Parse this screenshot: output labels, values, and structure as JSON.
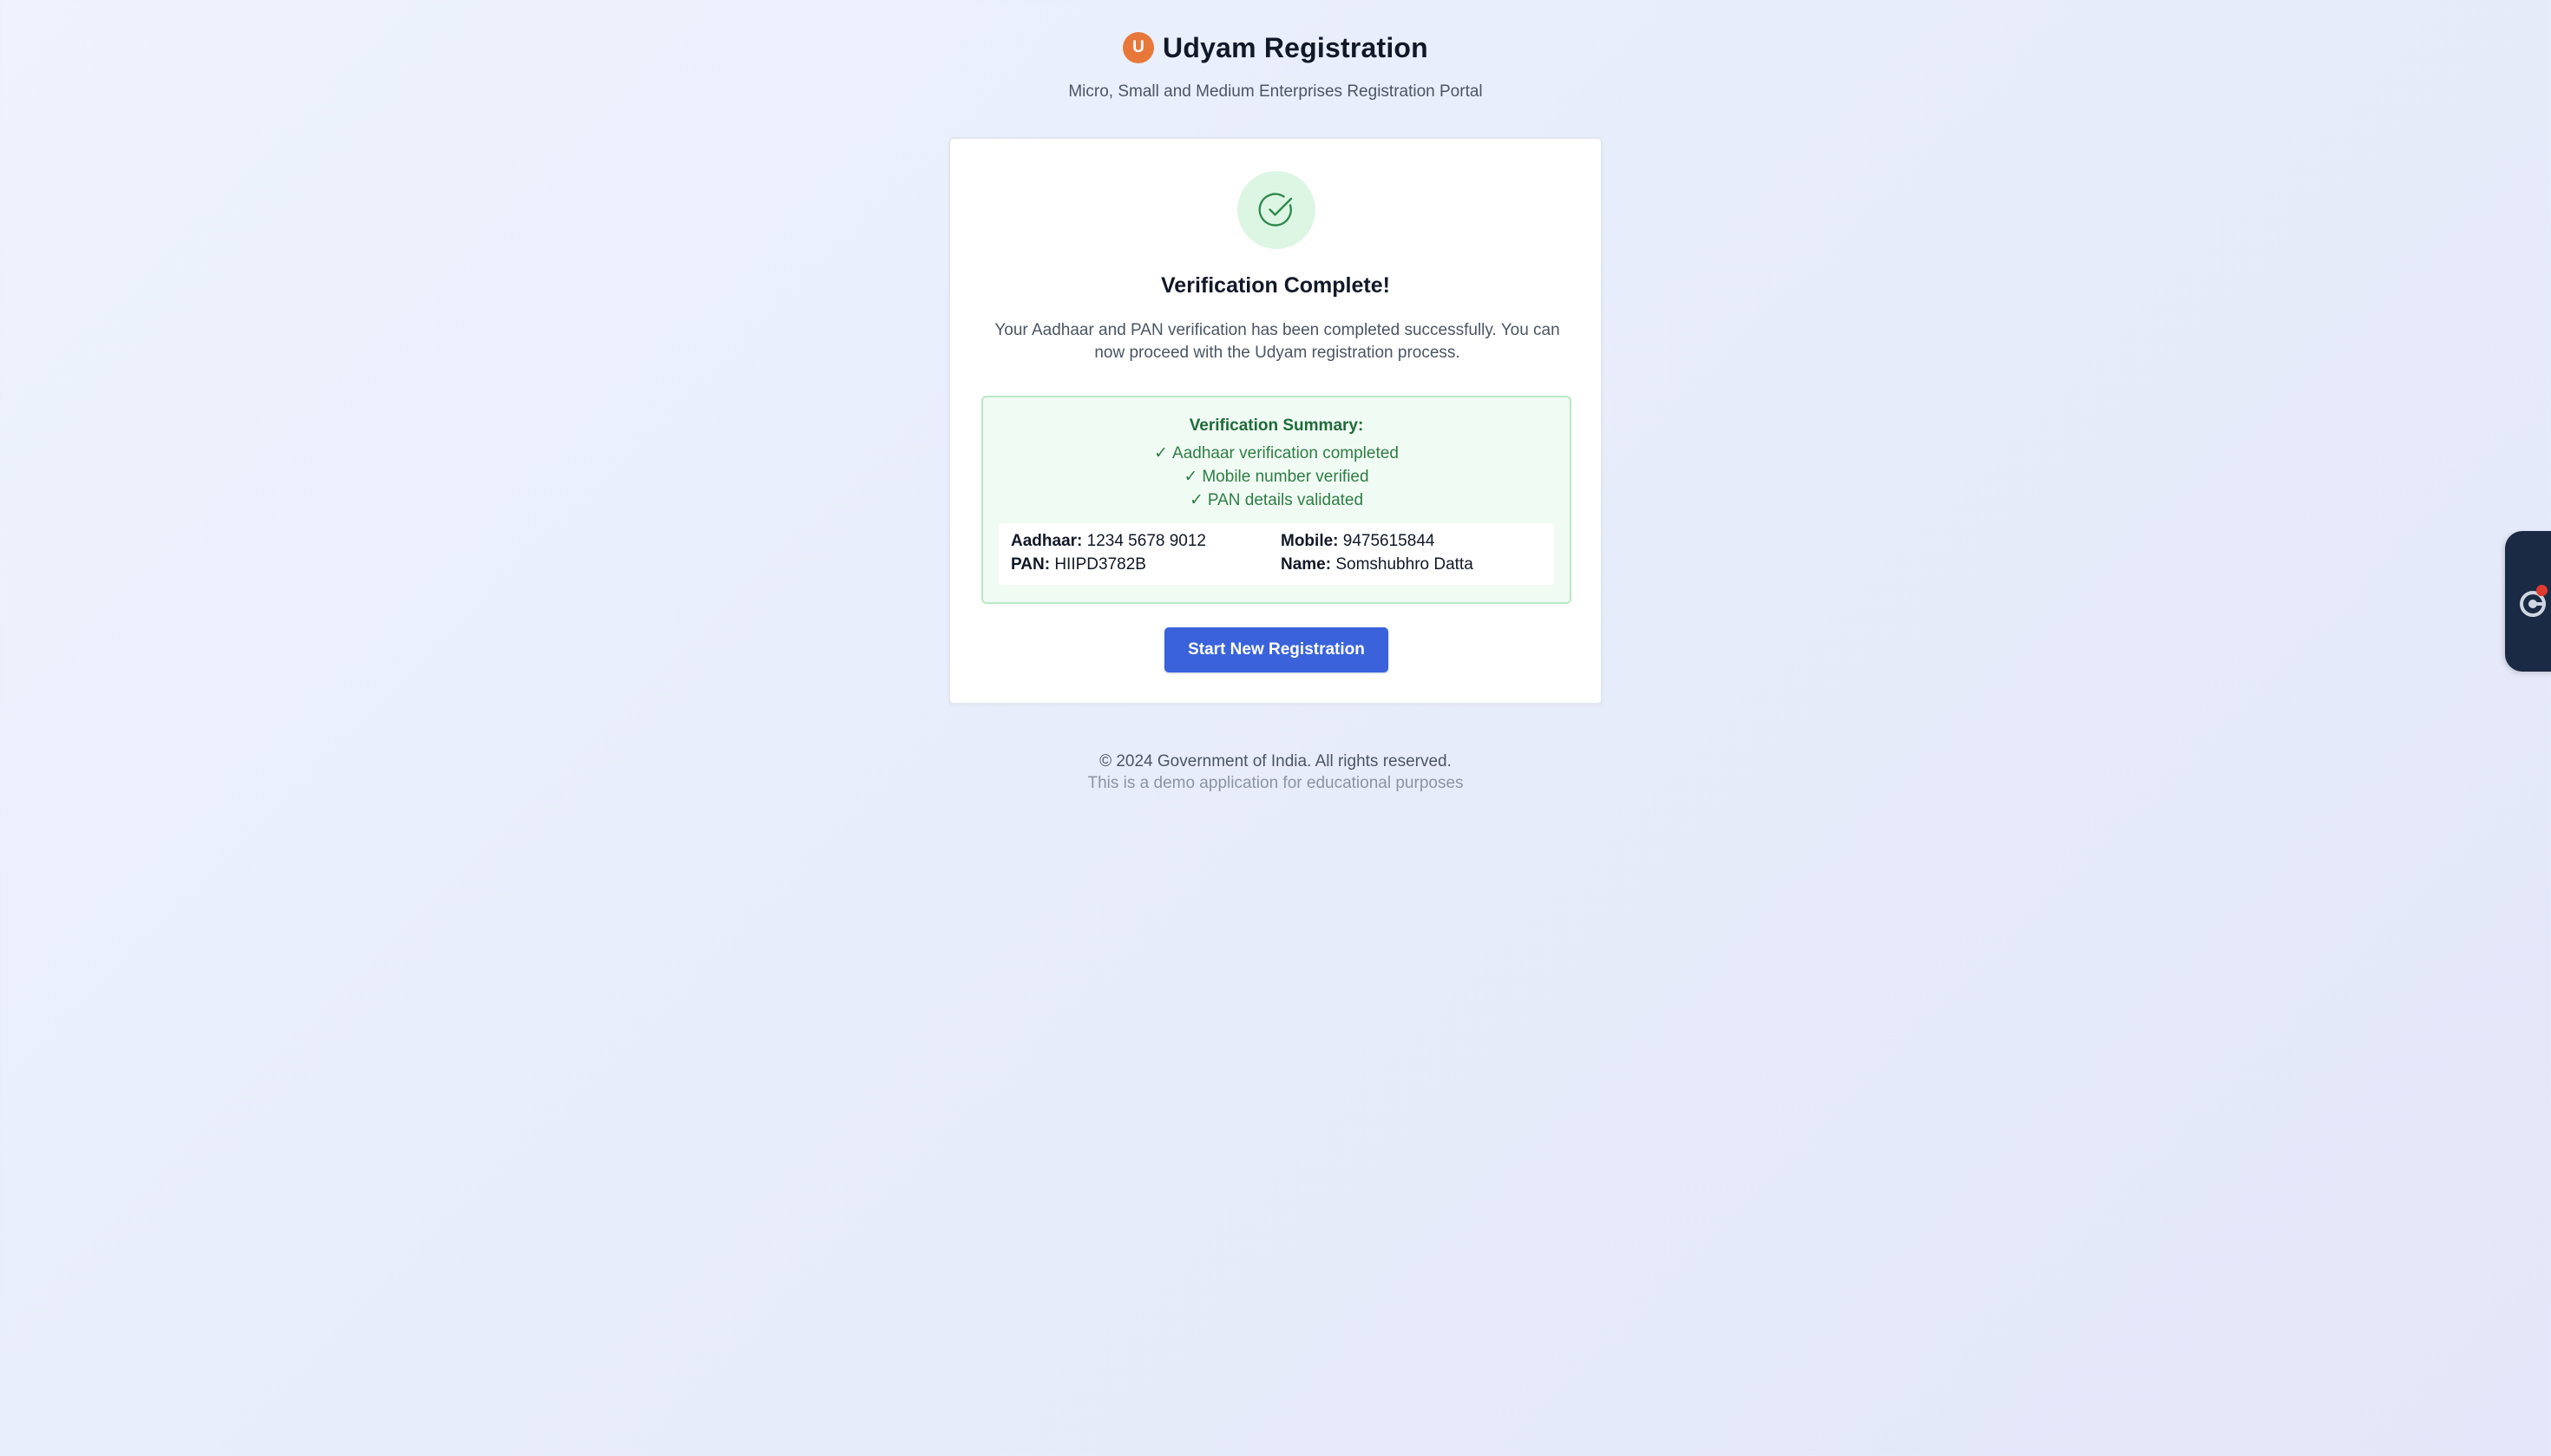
{
  "header": {
    "logo_letter": "U",
    "title": "Udyam Registration",
    "subtitle": "Micro, Small and Medium Enterprises Registration Portal"
  },
  "card": {
    "icon": "check-circle-icon",
    "title": "Verification Complete!",
    "message": "Your Aadhaar and PAN verification has been completed successfully. You can now proceed with the Udyam registration process.",
    "summary": {
      "title": "Verification Summary:",
      "check_glyph": "✓",
      "items": [
        "Aadhaar verification completed",
        "Mobile number verified",
        "PAN details validated"
      ]
    },
    "details": {
      "aadhaar_label": "Aadhaar:",
      "aadhaar_value": "1234 5678 9012",
      "mobile_label": "Mobile:",
      "mobile_value": "9475615844",
      "pan_label": "PAN:",
      "pan_value": "HIIPD3782B",
      "name_label": "Name:",
      "name_value": "Somshubhro Datta"
    },
    "button_label": "Start New Registration"
  },
  "footer": {
    "copyright": "© 2024 Government of India. All rights reserved.",
    "note": "This is a demo application for educational purposes"
  },
  "widget": {
    "icon": "assistant-icon"
  },
  "colors": {
    "brand_orange": "#e8773a",
    "primary_blue": "#3a63db",
    "success_green": "#2f7d45",
    "success_bg": "#f0fbf3",
    "widget_bg": "#1b2a44",
    "notification_red": "#e03a2f"
  }
}
